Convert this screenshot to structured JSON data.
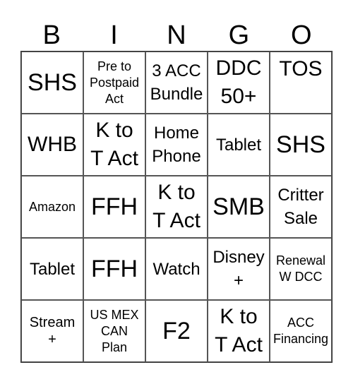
{
  "card": {
    "header": [
      "B",
      "I",
      "N",
      "G",
      "O"
    ],
    "rows": [
      [
        {
          "text": "SHS",
          "size": "xl"
        },
        {
          "text": "Pre to\nPostpaid\nAct",
          "size": "xs"
        },
        {
          "text": "3 ACC\nBundle",
          "size": "m"
        },
        {
          "text": "DDC\n50+",
          "size": "l"
        },
        {
          "text": "TOS",
          "size": "l",
          "align": "top"
        }
      ],
      [
        {
          "text": "WHB",
          "size": "l"
        },
        {
          "text": "K to\nT Act",
          "size": "l"
        },
        {
          "text": "Home\nPhone",
          "size": "m"
        },
        {
          "text": "Tablet",
          "size": "m"
        },
        {
          "text": "SHS",
          "size": "xl"
        }
      ],
      [
        {
          "text": "Amazon",
          "size": "xs"
        },
        {
          "text": "FFH",
          "size": "xl"
        },
        {
          "text": "K to\nT Act",
          "size": "l"
        },
        {
          "text": "SMB",
          "size": "xl"
        },
        {
          "text": "Critter\nSale",
          "size": "m"
        }
      ],
      [
        {
          "text": "Tablet",
          "size": "m"
        },
        {
          "text": "FFH",
          "size": "xl"
        },
        {
          "text": "Watch",
          "size": "m"
        },
        {
          "text": "Disney\n+",
          "size": "m"
        },
        {
          "text": "Renewal\nW DCC",
          "size": "xs"
        }
      ],
      [
        {
          "text": "Stream\n+",
          "size": "s"
        },
        {
          "text": "US MEX\nCAN\nPlan",
          "size": "xs"
        },
        {
          "text": "F2",
          "size": "xl"
        },
        {
          "text": "K to\nT Act",
          "size": "l"
        },
        {
          "text": "ACC\nFinancing",
          "size": "xs"
        }
      ]
    ]
  }
}
